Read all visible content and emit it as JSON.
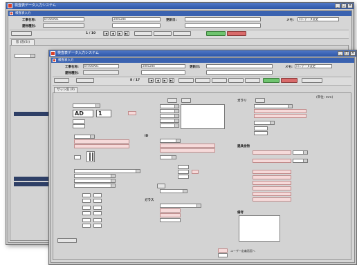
{
  "back_window": {
    "title": "検査表データ入力システム",
    "inner_title": "検査表入力",
    "win_controls": [
      "_",
      "□",
      "×"
    ],
    "header_row1": {
      "label1": "工事名称:",
      "value1": "BT036A01",
      "label2": "",
      "value2": "2001204",
      "label3": "更新日:",
      "label4": "メモ:",
      "value4": "ロンデーヌ変更"
    },
    "header_row2": {
      "label1": "建物種別:",
      "value1": "",
      "label2": "",
      "value2": "",
      "label3": ""
    },
    "page_counter": "1 / 10",
    "tab_label": "窓 (窓(S))",
    "side_labels": [
      "",
      "",
      "",
      "",
      "",
      "",
      "",
      "",
      ""
    ]
  },
  "front_window": {
    "title": "検査表データ入力システム",
    "inner_title": "検査表入力",
    "win_controls": [
      "_",
      "□",
      "×"
    ],
    "header_row1": {
      "label1": "工事名称:",
      "value1": "BT036A01",
      "label2": "",
      "value2": "2001204",
      "label3": "更新日:",
      "label4": "メモ:",
      "value4": "ロンデーヌ変更"
    },
    "header_row2": {
      "label1": "建物種別:",
      "value1": "",
      "label2": "",
      "value2": "",
      "label3": ""
    },
    "page_counter": "8 / 17",
    "tab_label": "サッシ窓 (P)",
    "unit_note": "(単位: mm)",
    "toolbar_buttons": [
      "",
      "",
      "",
      "",
      "",
      "",
      "",
      "",
      "",
      ""
    ],
    "left": {
      "section_title": "",
      "first_value": "",
      "code_big": "AD",
      "code_num": "1",
      "rows": [
        "",
        "",
        "",
        "",
        "",
        "",
        "",
        "",
        ""
      ]
    },
    "middle": {
      "section1": "",
      "section2": "ID",
      "section3": "",
      "section4": "ガラス",
      "pink_values": [
        "",
        "",
        "",
        "",
        ""
      ]
    },
    "right": {
      "section1": "ガラリ",
      "section2": "建具金物",
      "section3": "備考",
      "items": [
        "",
        "",
        "",
        "",
        "",
        "",
        "",
        ""
      ]
    },
    "footer_note1": "ユーザー定義画面へ",
    "footer_note2": "",
    "footer_note3": "",
    "footer_note4": ""
  },
  "colors": {
    "title_blue": "#2d55a6",
    "window_gray": "#c9c9c9",
    "field_pink": "#f6dada",
    "green": "#6fc46f",
    "red": "#d96b6b"
  }
}
